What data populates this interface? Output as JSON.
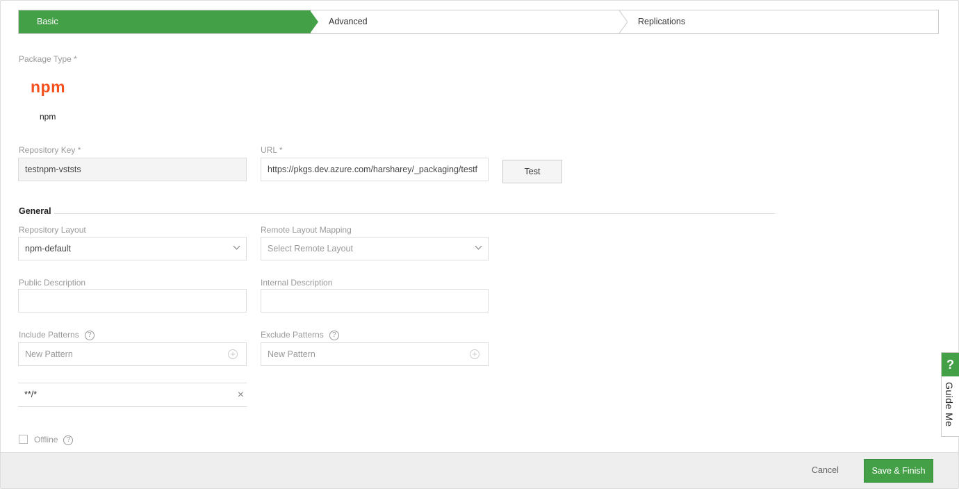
{
  "steps": [
    "Basic",
    "Advanced",
    "Replications"
  ],
  "package_type": {
    "label": "Package Type *",
    "logo": "npm",
    "name": "npm"
  },
  "repo_key": {
    "label": "Repository Key *",
    "value": "testnpm-vststs"
  },
  "url": {
    "label": "URL *",
    "value": "https://pkgs.dev.azure.com/harsharey/_packaging/testf"
  },
  "test_button": "Test",
  "general": {
    "title": "General",
    "repo_layout": {
      "label": "Repository Layout",
      "value": "npm-default"
    },
    "remote_layout": {
      "label": "Remote Layout Mapping",
      "placeholder": "Select Remote Layout"
    },
    "public_desc": {
      "label": "Public Description",
      "value": ""
    },
    "internal_desc": {
      "label": "Internal Description",
      "value": ""
    },
    "include": {
      "label": "Include Patterns",
      "placeholder": "New Pattern",
      "items": [
        "**/*"
      ]
    },
    "exclude": {
      "label": "Exclude Patterns",
      "placeholder": "New Pattern"
    },
    "offline": {
      "label": "Offline",
      "checked": false
    }
  },
  "footer": {
    "cancel": "Cancel",
    "save": "Save & Finish"
  },
  "guide": {
    "icon": "?",
    "label": "Guide Me"
  },
  "colors": {
    "accent": "#43a047",
    "npm": "#f4511e"
  }
}
